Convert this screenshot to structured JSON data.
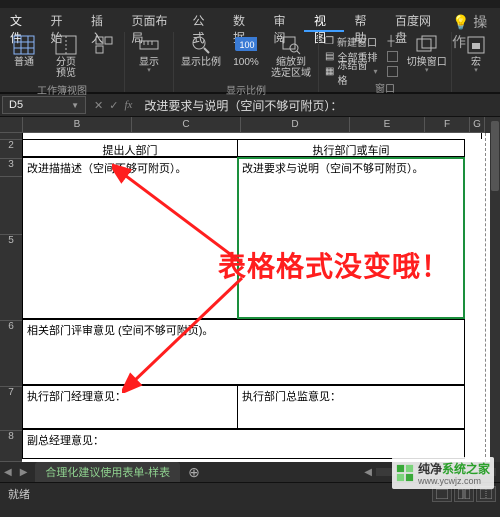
{
  "menu": {
    "file": "文件",
    "home": "开始",
    "insert": "插入",
    "layout": "页面布局",
    "formula": "公式",
    "data": "数据",
    "review": "审阅",
    "view": "视图",
    "help": "帮助",
    "baidu": "百度网盘",
    "search_label": "操作"
  },
  "ribbon": {
    "view_group": "工作簿视图",
    "normal": "普通",
    "page_preview": "分页\n预览",
    "show": "显示",
    "zoom_group": "显示比例",
    "zoom": "显示比例",
    "hundred": "100%",
    "zoom_sel": "缩放到\n选定区域",
    "window_group": "窗口",
    "new_window": "新建窗口",
    "arrange_all": "全部重排",
    "freeze": "冻结窗格",
    "switch": "切换窗口",
    "macro": "宏"
  },
  "fbar": {
    "name": "D5",
    "cancel": "✕",
    "enter": "✓",
    "fx": "fx",
    "formula": "改进要求与说明（空间不够可附页）："
  },
  "cols": {
    "B": "B",
    "C": "C",
    "D": "D",
    "E": "E",
    "F": "F",
    "G": "G"
  },
  "rows": {
    "r2": "2",
    "r3": "3",
    "r4": "",
    "r5": "5",
    "r6": "6",
    "r7": "7",
    "r8": "8"
  },
  "sheet": {
    "hdr_left": "提出人部门",
    "hdr_right": "执行部门或车间",
    "cell_left": "改进描描述（空间不够可附页）。",
    "cell_right": "改进要求与说明（空间不够可附页）。",
    "row6": "相关部门评审意见 (空间不够可附页)。",
    "row7_left": "执行部门经理意见：",
    "row7_right": "执行部门总监意见：",
    "row8": "副总经理意见："
  },
  "annot": "表格格式没变哦！",
  "tabs": {
    "sheet1": "合理化建议使用表单-样表"
  },
  "status": {
    "ready": "就绪"
  },
  "watermark": {
    "t1": "纯净",
    "t2": "系统之家",
    "url": "www.ycwjz.com"
  }
}
